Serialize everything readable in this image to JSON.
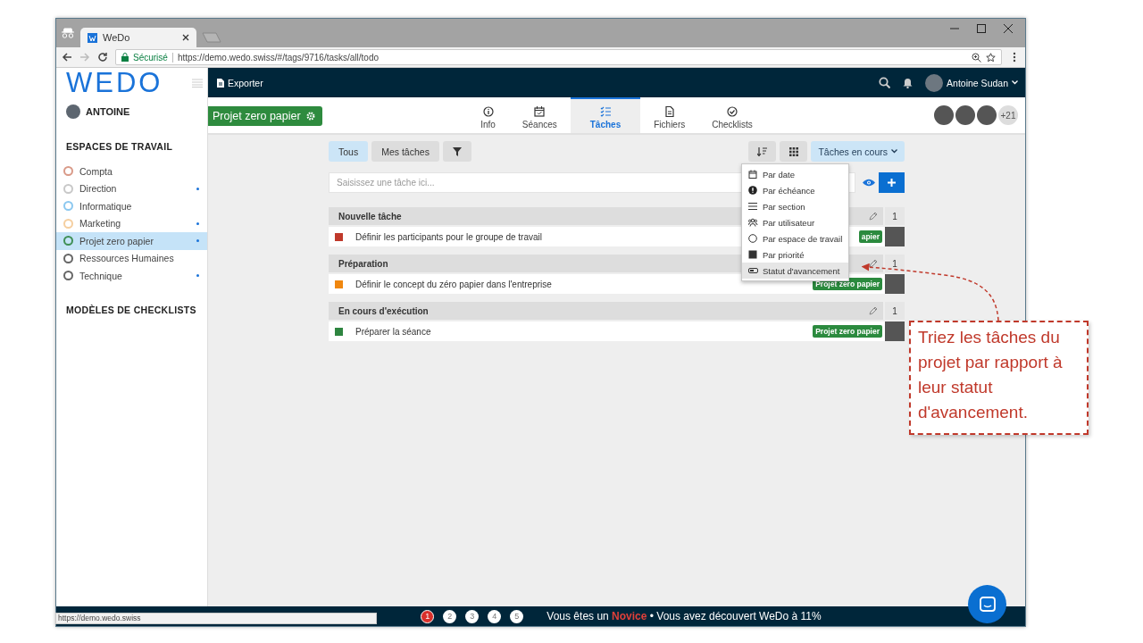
{
  "browser": {
    "tab_title": "WeDo",
    "security_label": "Sécurisé",
    "url": "https://demo.wedo.swiss/#/tags/9716/tasks/all/todo",
    "status_url": "https://demo.wedo.swiss"
  },
  "sidebar": {
    "logo": "WEDO",
    "user": "ANTOINE",
    "workspaces_heading": "ESPACES DE TRAVAIL",
    "workspaces": [
      {
        "label": "Compta",
        "color": "#d99a88",
        "selected": false,
        "unread": false
      },
      {
        "label": "Direction",
        "color": "#c8c8c8",
        "selected": false,
        "unread": true
      },
      {
        "label": "Informatique",
        "color": "#8cc8f0",
        "selected": false,
        "unread": false
      },
      {
        "label": "Marketing",
        "color": "#f5cfa0",
        "selected": false,
        "unread": true
      },
      {
        "label": "Projet zero papier",
        "color": "#3f8f55",
        "selected": true,
        "unread": true
      },
      {
        "label": "Ressources Humaines",
        "color": "#666666",
        "selected": false,
        "unread": false
      },
      {
        "label": "Technique",
        "color": "#666666",
        "selected": false,
        "unread": true
      }
    ],
    "checklists_heading": "MODÈLES DE CHECKLISTS"
  },
  "topbar": {
    "export_label": "Exporter",
    "user_name": "Antoine Sudan"
  },
  "project": {
    "name": "Projet zero papier",
    "member_overflow": "+21"
  },
  "tabs": [
    {
      "label": "Info",
      "selected": false
    },
    {
      "label": "Séances",
      "selected": false
    },
    {
      "label": "Tâches",
      "selected": true
    },
    {
      "label": "Fichiers",
      "selected": false
    },
    {
      "label": "Checklists",
      "selected": false
    }
  ],
  "filters": [
    {
      "label": "Tous",
      "selected": true
    },
    {
      "label": "Mes tâches",
      "selected": false
    }
  ],
  "status_filter": "Tâches en cours",
  "task_input": {
    "placeholder": "Saisissez une tâche ici..."
  },
  "sort_menu": [
    {
      "label": "Par date",
      "selected": false
    },
    {
      "label": "Par échéance",
      "selected": false
    },
    {
      "label": "Par section",
      "selected": false
    },
    {
      "label": "Par utilisateur",
      "selected": false
    },
    {
      "label": "Par espace de travail",
      "selected": false
    },
    {
      "label": "Par priorité",
      "selected": false
    },
    {
      "label": "Statut d'avancement",
      "selected": true
    }
  ],
  "sections": [
    {
      "title": "Nouvelle tâche",
      "count": "1",
      "tasks": [
        {
          "title": "Définir les participants pour le groupe de travail",
          "color": "#c0392b",
          "tag": "apier"
        }
      ]
    },
    {
      "title": "Préparation",
      "count": "1",
      "tasks": [
        {
          "title": "Définir le concept du zéro papier dans l'entreprise",
          "color": "#f0870f",
          "tag": "Projet zero papier"
        }
      ]
    },
    {
      "title": "En cours d'exécution",
      "count": "1",
      "tasks": [
        {
          "title": "Préparer la séance",
          "color": "#2e8540",
          "tag": "Projet zero papier"
        }
      ]
    }
  ],
  "footer": {
    "steps": [
      {
        "label": "1",
        "selected": true
      },
      {
        "label": "2",
        "selected": false
      },
      {
        "label": "3",
        "selected": false
      },
      {
        "label": "4",
        "selected": false
      },
      {
        "label": "5",
        "selected": false
      }
    ],
    "message": "Vous êtes un **Novice** • Vous avez découvert WeDo à 11%"
  },
  "callout": "Triez les tâches du projet par rapport à leur statut d'avancement."
}
